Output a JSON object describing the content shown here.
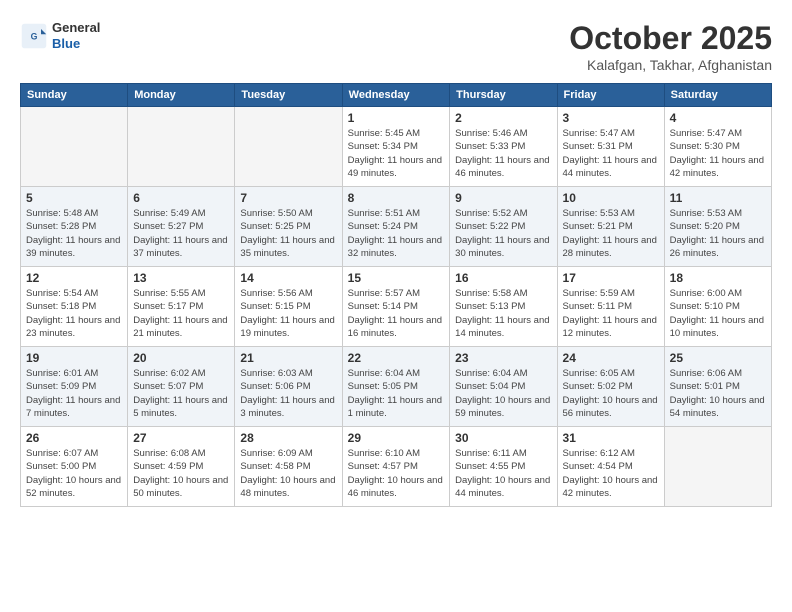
{
  "header": {
    "logo": {
      "general": "General",
      "blue": "Blue"
    },
    "title": "October 2025",
    "subtitle": "Kalafgan, Takhar, Afghanistan"
  },
  "weekdays": [
    "Sunday",
    "Monday",
    "Tuesday",
    "Wednesday",
    "Thursday",
    "Friday",
    "Saturday"
  ],
  "weeks": [
    [
      {
        "day": "",
        "info": ""
      },
      {
        "day": "",
        "info": ""
      },
      {
        "day": "",
        "info": ""
      },
      {
        "day": "1",
        "info": "Sunrise: 5:45 AM\nSunset: 5:34 PM\nDaylight: 11 hours\nand 49 minutes."
      },
      {
        "day": "2",
        "info": "Sunrise: 5:46 AM\nSunset: 5:33 PM\nDaylight: 11 hours\nand 46 minutes."
      },
      {
        "day": "3",
        "info": "Sunrise: 5:47 AM\nSunset: 5:31 PM\nDaylight: 11 hours\nand 44 minutes."
      },
      {
        "day": "4",
        "info": "Sunrise: 5:47 AM\nSunset: 5:30 PM\nDaylight: 11 hours\nand 42 minutes."
      }
    ],
    [
      {
        "day": "5",
        "info": "Sunrise: 5:48 AM\nSunset: 5:28 PM\nDaylight: 11 hours\nand 39 minutes."
      },
      {
        "day": "6",
        "info": "Sunrise: 5:49 AM\nSunset: 5:27 PM\nDaylight: 11 hours\nand 37 minutes."
      },
      {
        "day": "7",
        "info": "Sunrise: 5:50 AM\nSunset: 5:25 PM\nDaylight: 11 hours\nand 35 minutes."
      },
      {
        "day": "8",
        "info": "Sunrise: 5:51 AM\nSunset: 5:24 PM\nDaylight: 11 hours\nand 32 minutes."
      },
      {
        "day": "9",
        "info": "Sunrise: 5:52 AM\nSunset: 5:22 PM\nDaylight: 11 hours\nand 30 minutes."
      },
      {
        "day": "10",
        "info": "Sunrise: 5:53 AM\nSunset: 5:21 PM\nDaylight: 11 hours\nand 28 minutes."
      },
      {
        "day": "11",
        "info": "Sunrise: 5:53 AM\nSunset: 5:20 PM\nDaylight: 11 hours\nand 26 minutes."
      }
    ],
    [
      {
        "day": "12",
        "info": "Sunrise: 5:54 AM\nSunset: 5:18 PM\nDaylight: 11 hours\nand 23 minutes."
      },
      {
        "day": "13",
        "info": "Sunrise: 5:55 AM\nSunset: 5:17 PM\nDaylight: 11 hours\nand 21 minutes."
      },
      {
        "day": "14",
        "info": "Sunrise: 5:56 AM\nSunset: 5:15 PM\nDaylight: 11 hours\nand 19 minutes."
      },
      {
        "day": "15",
        "info": "Sunrise: 5:57 AM\nSunset: 5:14 PM\nDaylight: 11 hours\nand 16 minutes."
      },
      {
        "day": "16",
        "info": "Sunrise: 5:58 AM\nSunset: 5:13 PM\nDaylight: 11 hours\nand 14 minutes."
      },
      {
        "day": "17",
        "info": "Sunrise: 5:59 AM\nSunset: 5:11 PM\nDaylight: 11 hours\nand 12 minutes."
      },
      {
        "day": "18",
        "info": "Sunrise: 6:00 AM\nSunset: 5:10 PM\nDaylight: 11 hours\nand 10 minutes."
      }
    ],
    [
      {
        "day": "19",
        "info": "Sunrise: 6:01 AM\nSunset: 5:09 PM\nDaylight: 11 hours\nand 7 minutes."
      },
      {
        "day": "20",
        "info": "Sunrise: 6:02 AM\nSunset: 5:07 PM\nDaylight: 11 hours\nand 5 minutes."
      },
      {
        "day": "21",
        "info": "Sunrise: 6:03 AM\nSunset: 5:06 PM\nDaylight: 11 hours\nand 3 minutes."
      },
      {
        "day": "22",
        "info": "Sunrise: 6:04 AM\nSunset: 5:05 PM\nDaylight: 11 hours\nand 1 minute."
      },
      {
        "day": "23",
        "info": "Sunrise: 6:04 AM\nSunset: 5:04 PM\nDaylight: 10 hours\nand 59 minutes."
      },
      {
        "day": "24",
        "info": "Sunrise: 6:05 AM\nSunset: 5:02 PM\nDaylight: 10 hours\nand 56 minutes."
      },
      {
        "day": "25",
        "info": "Sunrise: 6:06 AM\nSunset: 5:01 PM\nDaylight: 10 hours\nand 54 minutes."
      }
    ],
    [
      {
        "day": "26",
        "info": "Sunrise: 6:07 AM\nSunset: 5:00 PM\nDaylight: 10 hours\nand 52 minutes."
      },
      {
        "day": "27",
        "info": "Sunrise: 6:08 AM\nSunset: 4:59 PM\nDaylight: 10 hours\nand 50 minutes."
      },
      {
        "day": "28",
        "info": "Sunrise: 6:09 AM\nSunset: 4:58 PM\nDaylight: 10 hours\nand 48 minutes."
      },
      {
        "day": "29",
        "info": "Sunrise: 6:10 AM\nSunset: 4:57 PM\nDaylight: 10 hours\nand 46 minutes."
      },
      {
        "day": "30",
        "info": "Sunrise: 6:11 AM\nSunset: 4:55 PM\nDaylight: 10 hours\nand 44 minutes."
      },
      {
        "day": "31",
        "info": "Sunrise: 6:12 AM\nSunset: 4:54 PM\nDaylight: 10 hours\nand 42 minutes."
      },
      {
        "day": "",
        "info": ""
      }
    ]
  ]
}
